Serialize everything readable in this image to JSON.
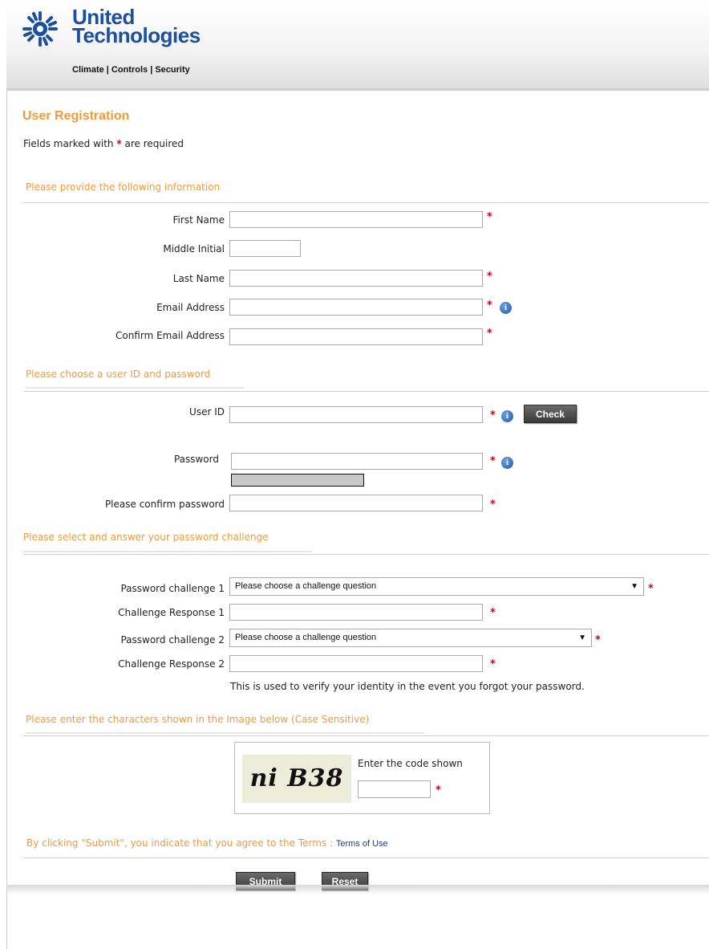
{
  "brand": {
    "name_line1": "United",
    "name_line2": "Technologies",
    "tagline": "Climate | Controls | Security"
  },
  "page": {
    "title": "User Registration",
    "required_note_prefix": "Fields marked with",
    "required_symbol": "*",
    "required_note_suffix": "are required"
  },
  "sections": {
    "info": "Please provide the following information",
    "account": "Please choose a user ID and password",
    "challenge": "Please select and answer your password challenge",
    "captcha": "Please enter the characters shown in the Image below (Case Sensitive)"
  },
  "fields": {
    "first_name": "First Name",
    "middle_initial": "Middle Initial",
    "last_name": "Last Name",
    "email": "Email Address",
    "confirm_email": "Confirm Email Address",
    "user_id": "User ID",
    "password": "Password",
    "confirm_password": "Please confirm password",
    "challenge1": "Password challenge 1",
    "response1": "Challenge Response 1",
    "challenge2": "Password challenge 2",
    "response2": "Challenge Response 2"
  },
  "selects": {
    "challenge1_value": "Please choose a challenge question",
    "challenge2_value": "Please choose a challenge question"
  },
  "help_text": "This is used to verify your identity in the event you forgot your password.",
  "captcha": {
    "code_image_text": "ni B38",
    "prompt": "Enter the code shown"
  },
  "terms": {
    "text": "By clicking \"Submit\", you indicate that you agree to the Terms :",
    "link": "Terms of Use"
  },
  "buttons": {
    "check": "Check",
    "submit": "Submit",
    "reset": "Reset"
  },
  "icons": {
    "info": "i"
  },
  "colors": {
    "accent_orange": "#f29a3a",
    "brand_blue": "#1b4fa3",
    "required_red": "#d0021b"
  }
}
